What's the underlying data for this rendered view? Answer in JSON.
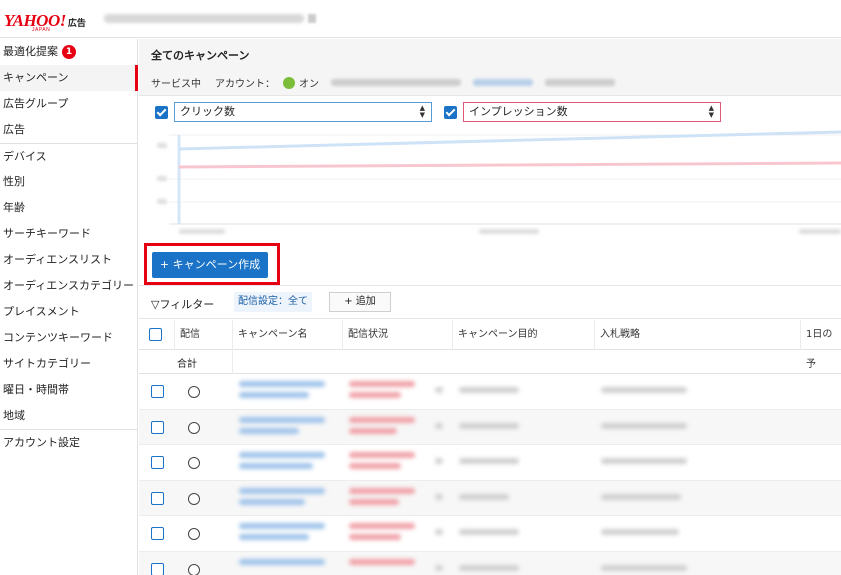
{
  "brand": {
    "logo_text": "YAHOO!",
    "logo_sub": "JAPAN",
    "product": "広告"
  },
  "sidebar": {
    "items": [
      {
        "label": "最適化提案",
        "badge": "1"
      },
      {
        "label": "キャンペーン"
      },
      {
        "label": "広告グループ"
      },
      {
        "label": "広告"
      },
      {
        "label": "デバイス"
      },
      {
        "label": "性別"
      },
      {
        "label": "年齢"
      },
      {
        "label": "サーチキーワード"
      },
      {
        "label": "オーディエンスリスト"
      },
      {
        "label": "オーディエンスカテゴリー"
      },
      {
        "label": "プレイスメント"
      },
      {
        "label": "コンテンツキーワード"
      },
      {
        "label": "サイトカテゴリー"
      },
      {
        "label": "曜日・時間帯"
      },
      {
        "label": "地域"
      },
      {
        "label": "アカウント設定"
      }
    ]
  },
  "header": {
    "title": "全てのキャンペーン",
    "service_label": "サービス中",
    "account_label": "アカウント：",
    "account_status": "オン"
  },
  "metrics": {
    "left": "クリック数",
    "right": "インプレッション数"
  },
  "toolbar": {
    "create_label": "+ キャンペーン作成",
    "filter_label": "フィルター",
    "filter_chip": "配信設定：全て",
    "add_label": "+  追加"
  },
  "table": {
    "columns": [
      "配信",
      "キャンペーン名",
      "配信状況",
      "キャンペーン目的",
      "入札戦略",
      "1日の予"
    ],
    "total_label": "合計"
  },
  "colors": {
    "accent_blue": "#1a73c6",
    "brand_red": "#e60012",
    "status_green": "#7cbe3a",
    "series_click": "#cfe3f7",
    "series_impression": "#f8c6cf"
  }
}
